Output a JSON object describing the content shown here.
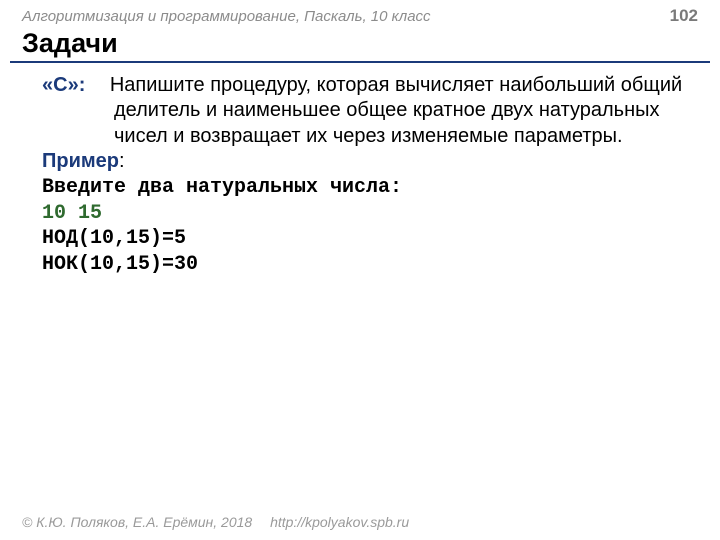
{
  "header": {
    "course": "Алгоритмизация и программирование, Паскаль, 10 класс",
    "page": "102"
  },
  "title": "Задачи",
  "task": {
    "label": "«C»:",
    "text": "Напишите процедуру, которая вычисляет наибольший общий делитель и наименьшее общее кратное двух натуральных чисел и возвращает их через изменяемые параметры."
  },
  "example": {
    "label": "Пример",
    "colon": ":",
    "lines": {
      "prompt": "Введите два натуральных числа:",
      "input": "10 15",
      "out1": "НОД(10,15)=5",
      "out2": "НОК(10,15)=30"
    }
  },
  "footer": {
    "copyright": "© К.Ю. Поляков, Е.А. Ерёмин, 2018",
    "url": "http://kpolyakov.spb.ru"
  }
}
